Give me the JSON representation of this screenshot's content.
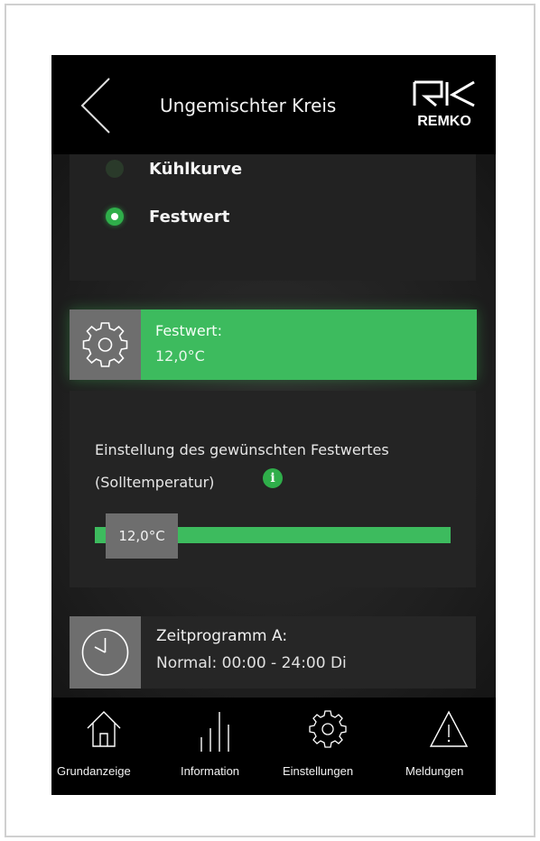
{
  "header": {
    "title": "Ungemischter Kreis",
    "logo_text": "REMKO"
  },
  "mode_options": [
    {
      "label": "Kühlkurve",
      "selected": false
    },
    {
      "label": "Festwert",
      "selected": true
    }
  ],
  "festwert_bar": {
    "title": "Festwert:",
    "value": "12,0°C",
    "icon": "gear-icon"
  },
  "setting": {
    "description": "Einstellung des gewünschten Festwertes (Solltemperatur)",
    "info_icon_glyph": "i",
    "slider_value": "12,0°C"
  },
  "zeitprogramm": {
    "title": "Zeitprogramm A:",
    "subtitle": "Normal: 00:00 - 24:00 Di",
    "icon": "clock-icon"
  },
  "nav": {
    "items": [
      {
        "label": "Grundanzeige",
        "icon": "home-icon"
      },
      {
        "label": "Information",
        "icon": "bars-icon"
      },
      {
        "label": "Einstellungen",
        "icon": "gear-icon"
      },
      {
        "label": "Meldungen",
        "icon": "warning-icon"
      }
    ]
  },
  "colors": {
    "accent_green": "#3dbb5e",
    "background": "#1c1c1c",
    "header": "#000000",
    "icon_box": "#6e6e6e"
  }
}
